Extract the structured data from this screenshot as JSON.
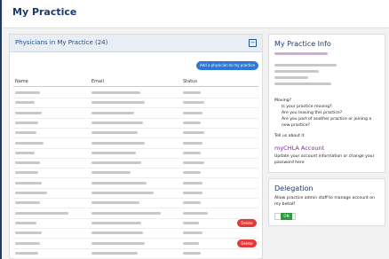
{
  "page": {
    "title": "My Practice"
  },
  "physicians": {
    "header": "Physicians in My Practice",
    "count": "(24)",
    "collapse_label": "−",
    "add_button": "Add a physician to my practice",
    "columns": {
      "name": "Name",
      "email": "Email",
      "status": "Status"
    },
    "rows": [
      {
        "delete": false
      },
      {
        "delete": false
      },
      {
        "delete": false
      },
      {
        "delete": false
      },
      {
        "delete": false
      },
      {
        "delete": false
      },
      {
        "delete": false
      },
      {
        "delete": false
      },
      {
        "delete": false
      },
      {
        "delete": false
      },
      {
        "delete": false
      },
      {
        "delete": false
      },
      {
        "delete": false
      },
      {
        "delete": true
      },
      {
        "delete": false
      },
      {
        "delete": true
      },
      {
        "delete": false
      }
    ],
    "delete_label": "Delete"
  },
  "info": {
    "title": "My Practice Info",
    "moving_label": "Moving?",
    "moving_questions": "Is your practice moving?\nAre you leaving this practice?\nAre you part of another practice or joining a new practice?",
    "tell_us": "Tell us about it",
    "account_link": "myCHLA Account",
    "account_text": "Update your account information or change your password here"
  },
  "delegation": {
    "title": "Delegation",
    "text": "Allow practice admin staff to manage account on my behalf",
    "toggle_label": "ON"
  },
  "colors": {
    "brand": "#1d3a6e",
    "link": "#7a2a9a",
    "delete": "#e23a3a",
    "toggle_on": "#2e9a3e",
    "add_button": "#2d78d4"
  }
}
